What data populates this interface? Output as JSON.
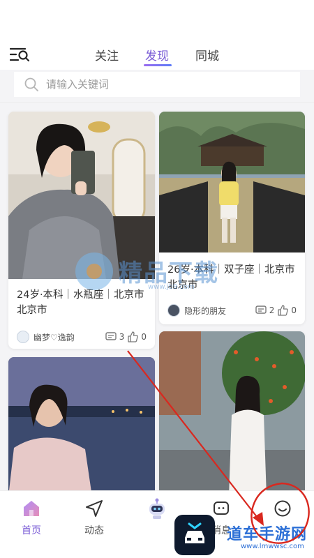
{
  "top_nav": {
    "tabs": [
      {
        "label": "关注",
        "active": false
      },
      {
        "label": "发现",
        "active": true
      },
      {
        "label": "同城",
        "active": false
      }
    ],
    "menu_icon": "menu-search-icon"
  },
  "search": {
    "placeholder": "请输入关键词",
    "icon": "search-icon"
  },
  "cards": [
    {
      "text": "24岁·本科｜水瓶座｜北京市 北京市",
      "author": "幽梦♡逸韵",
      "comments": "3",
      "likes": "0"
    },
    {
      "text": "26岁·本科｜双子座｜北京市 北京市",
      "author": "隐形的朋友",
      "comments": "2",
      "likes": "0"
    },
    {
      "text": "",
      "author": "",
      "comments": "",
      "likes": ""
    },
    {
      "text": "",
      "author": "",
      "comments": "",
      "likes": ""
    }
  ],
  "bottom_nav": {
    "items": [
      {
        "label": "首页",
        "icon": "home-icon",
        "active": true
      },
      {
        "label": "动态",
        "icon": "send-icon",
        "active": false
      },
      {
        "label": "",
        "icon": "robot-icon",
        "active": false
      },
      {
        "label": "消息",
        "icon": "message-icon",
        "active": false
      },
      {
        "label": "",
        "icon": "smile-icon",
        "active": false
      }
    ]
  },
  "watermarks": {
    "center_text": "精品下载",
    "center_url": "www.jb9.com",
    "brand_text": "道车手游网",
    "brand_url": "www.lmwwsc.com"
  },
  "colors": {
    "accent": "#7a5cd6",
    "annotation": "#d9281f"
  }
}
